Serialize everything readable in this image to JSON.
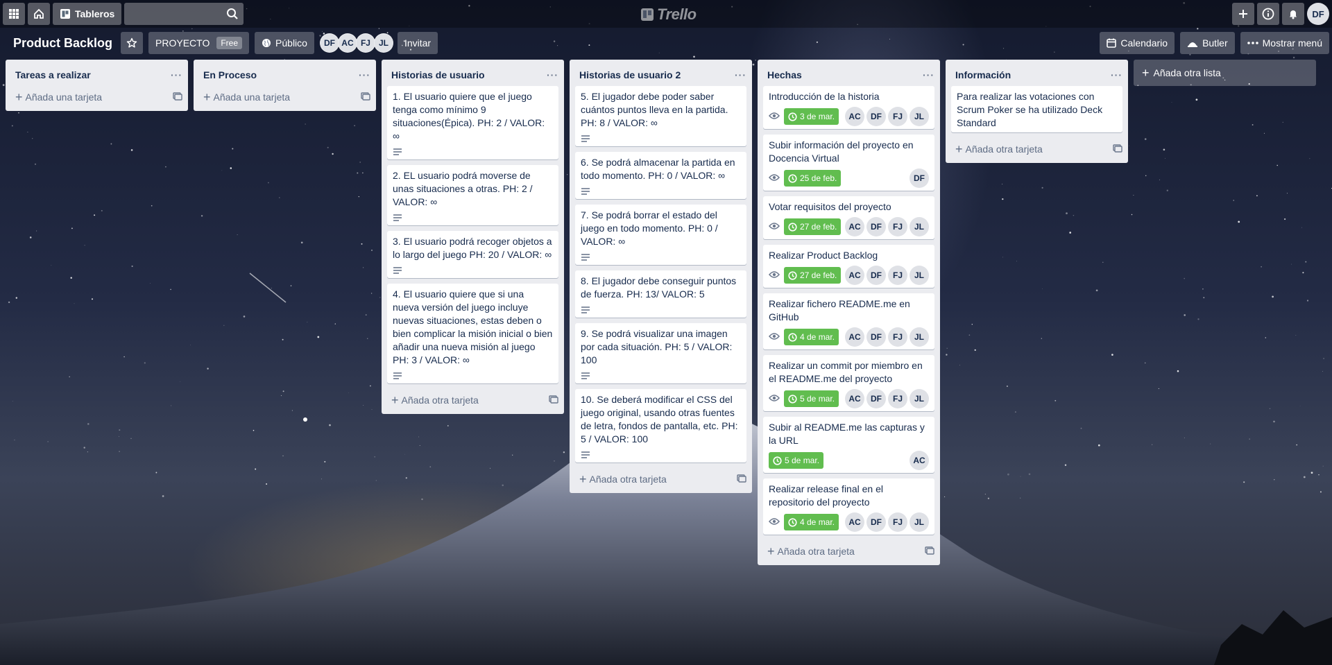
{
  "header": {
    "boards_label": "Tableros",
    "logo_text": "Trello",
    "user_initials": "DF"
  },
  "board": {
    "title": "Product Backlog",
    "team": "PROYECTO",
    "team_badge": "Free",
    "visibility": "Público",
    "members": [
      "DF",
      "AC",
      "FJ",
      "JL"
    ],
    "invite_label": "Invitar",
    "calendar_label": "Calendario",
    "butler_label": "Butler",
    "menu_label": "Mostrar menú"
  },
  "add_list_label": "Añada otra lista",
  "lists": [
    {
      "title": "Tareas a realizar",
      "add_label": "Añada una tarjeta",
      "cards": []
    },
    {
      "title": "En Proceso",
      "add_label": "Añada una tarjeta",
      "cards": []
    },
    {
      "title": "Historias de usuario",
      "add_label": "Añada otra tarjeta",
      "cards": [
        {
          "text": "1. El usuario quiere que el juego tenga como mínimo 9 situaciones(Épica). PH: 2 / VALOR: ∞"
        },
        {
          "text": "2. EL usuario podrá moverse de unas situaciones a otras. PH: 2 / VALOR: ∞"
        },
        {
          "text": "3. El usuario podrá recoger objetos a lo largo del juego PH: 20 / VALOR: ∞"
        },
        {
          "text": "4. El usuario quiere que si una nueva versión del juego incluye nuevas situaciones, estas deben o bien complicar la misión inicial o bien añadir una nueva misión al juego PH: 3 / VALOR: ∞"
        }
      ]
    },
    {
      "title": "Historias de usuario 2",
      "add_label": "Añada otra tarjeta",
      "cards": [
        {
          "text": "5. El jugador debe poder saber cuántos puntos lleva en la partida. PH: 8 / VALOR: ∞"
        },
        {
          "text": "6. Se podrá almacenar la partida en todo momento. PH: 0 / VALOR: ∞"
        },
        {
          "text": "7. Se podrá borrar el estado del juego en todo momento. PH: 0 / VALOR: ∞"
        },
        {
          "text": "8. El jugador debe conseguir puntos de fuerza. PH: 13/ VALOR: 5"
        },
        {
          "text": "9. Se podrá visualizar una imagen por cada situación. PH: 5 / VALOR: 100"
        },
        {
          "text": "10. Se deberá modificar el CSS del juego original, usando otras fuentes de letra, fondos de pantalla, etc. PH: 5 / VALOR: 100"
        }
      ]
    },
    {
      "title": "Hechas",
      "add_label": "Añada otra tarjeta",
      "cards": [
        {
          "text": "Introducción de la historia",
          "due": "3 de mar.",
          "members": [
            "AC",
            "DF",
            "FJ",
            "JL"
          ]
        },
        {
          "text": "Subir información del proyecto en Docencia Virtual",
          "due": "25 de feb.",
          "members": [
            "DF"
          ]
        },
        {
          "text": "Votar requisitos del proyecto",
          "due": "27 de feb.",
          "members": [
            "AC",
            "DF",
            "FJ",
            "JL"
          ]
        },
        {
          "text": "Realizar Product Backlog",
          "due": "27 de feb.",
          "members": [
            "AC",
            "DF",
            "FJ",
            "JL"
          ]
        },
        {
          "text": "Realizar fichero README.me en GitHub",
          "due": "4 de mar.",
          "members": [
            "AC",
            "DF",
            "FJ",
            "JL"
          ]
        },
        {
          "text": "Realizar un commit por miembro en el README.me del proyecto",
          "due": "5 de mar.",
          "members": [
            "AC",
            "DF",
            "FJ",
            "JL"
          ]
        },
        {
          "text": "Subir al README.me las capturas y la URL",
          "due": "5 de mar.",
          "members": [
            "AC"
          ]
        },
        {
          "text": "Realizar release final en el repositorio del proyecto",
          "due": "4 de mar.",
          "members": [
            "AC",
            "DF",
            "FJ",
            "JL"
          ]
        }
      ]
    },
    {
      "title": "Información",
      "add_label": "Añada otra tarjeta",
      "cards": [
        {
          "text": "Para realizar las votaciones con Scrum Poker se ha utilizado Deck Standard"
        }
      ]
    }
  ],
  "colors": {
    "due_green": "#61bd4f",
    "list_bg": "#ebecf0",
    "text": "#172b4d"
  }
}
